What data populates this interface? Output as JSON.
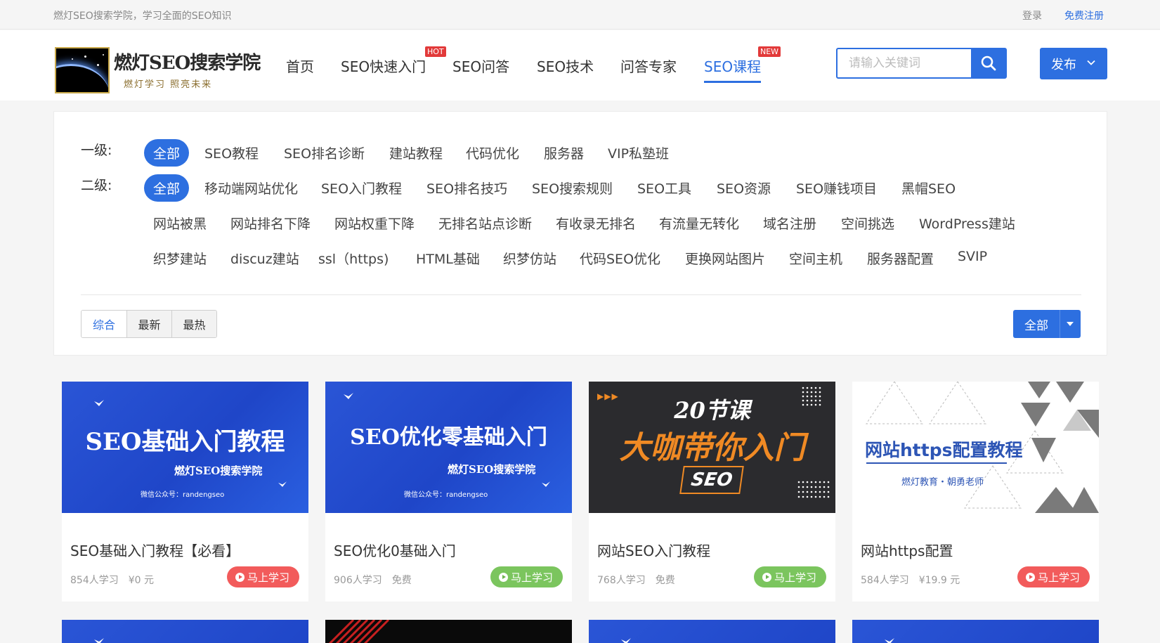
{
  "topbar": {
    "slogan": "燃灯SEO搜索学院，学习全面的SEO知识",
    "login": "登录",
    "register": "免费注册"
  },
  "logo": {
    "name": "燃灯SEO搜索学院",
    "tagline": "燃灯学习 照亮未来"
  },
  "nav": {
    "items": [
      {
        "label": "首页"
      },
      {
        "label": "SEO快速入门",
        "badge": "HOT"
      },
      {
        "label": "SEO问答"
      },
      {
        "label": "SEO技术"
      },
      {
        "label": "问答专家"
      },
      {
        "label": "SEO课程",
        "badge": "NEW",
        "active": true
      }
    ]
  },
  "search": {
    "placeholder": "请输入关键词",
    "icon": "search-icon"
  },
  "publish": {
    "label": "发布",
    "icon": "chevron-down-icon"
  },
  "filter": {
    "level1_label": "一级:",
    "level1": [
      "全部",
      "SEO教程",
      "SEO排名诊断",
      "建站教程",
      "代码优化",
      "服务器",
      "VIP私塾班"
    ],
    "level2_label": "二级:",
    "level2_row1": [
      "全部",
      "移动端网站优化",
      "SEO入门教程",
      "SEO排名技巧",
      "SEO搜索规则",
      "SEO工具",
      "SEO资源",
      "SEO赚钱项目",
      "黑帽SEO"
    ],
    "level2_row2": [
      "网站被黑",
      "网站排名下降",
      "网站权重下降",
      "无排名站点诊断",
      "有收录无排名",
      "有流量无转化",
      "域名注册",
      "空间挑选",
      "WordPress建站"
    ],
    "level2_row3": [
      "织梦建站",
      "discuz建站",
      "ssl（https)",
      "HTML基础",
      "织梦仿站",
      "代码SEO优化",
      "更换网站图片",
      "空间主机",
      "服务器配置",
      "SVIP"
    ],
    "sort": [
      "综合",
      "最新",
      "最热"
    ],
    "all_button": "全部"
  },
  "courses": [
    {
      "title": "SEO基础入门教程【必看】",
      "students": "854人学习",
      "price": "¥0 元",
      "cta": "马上学习",
      "cta_color": "#f25b5b",
      "thumb": {
        "headline": "SEO基础入门教程",
        "sub": "燃灯SEO搜索学院",
        "note": "微信公众号：randengseo"
      }
    },
    {
      "title": "SEO优化0基础入门",
      "students": "906人学习",
      "price": "免费",
      "cta": "马上学习",
      "cta_color": "#7bc55e",
      "thumb": {
        "headline": "SEO优化零基础入门",
        "sub": "燃灯SEO搜索学院",
        "note": "微信公众号：randengseo"
      }
    },
    {
      "title": "网站SEO入门教程",
      "students": "768人学习",
      "price": "免费",
      "cta": "马上学习",
      "cta_color": "#7bc55e",
      "thumb": {
        "line1": "20节课",
        "line2": "大咖带你入门",
        "line3": "SEO"
      }
    },
    {
      "title": "网站https配置",
      "students": "584人学习",
      "price": "¥19.9 元",
      "cta": "马上学习",
      "cta_color": "#f25b5b",
      "thumb": {
        "headline": "网站https配置教程",
        "sub": "燃灯教育・朝勇老师"
      }
    }
  ],
  "colors": {
    "accent": "#2d6fe0",
    "hot_badge": "#e23a3a",
    "cta_red": "#f25b5b",
    "cta_green": "#7bc55e"
  }
}
